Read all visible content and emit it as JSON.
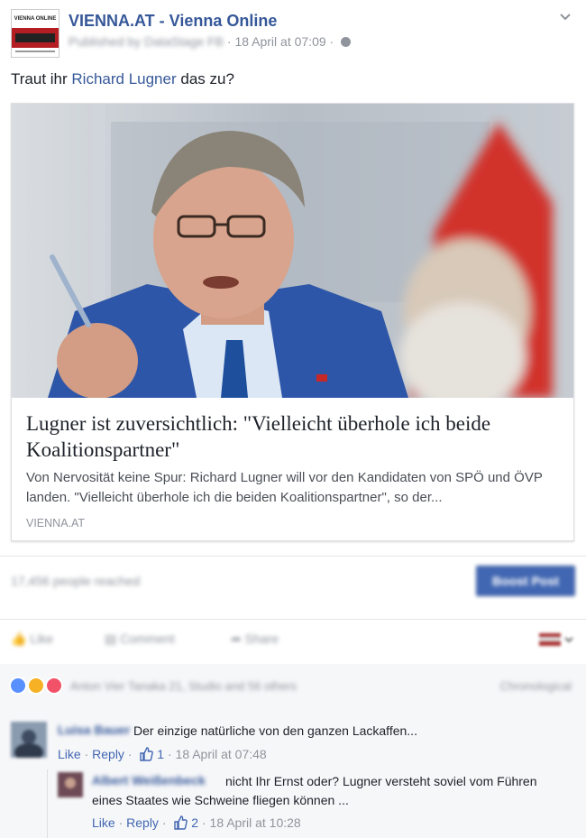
{
  "post": {
    "page_name": "VIENNA.AT - Vienna Online",
    "logo_text": "VIENNA ONLINE",
    "published_by": "Published by DataStage FB",
    "timestamp": "18 April at 07:09",
    "text_before": "Traut ihr ",
    "text_link": "Richard Lugner",
    "text_after": " das zu?"
  },
  "link_card": {
    "title": "Lugner ist zuversichtlich: \"Vielleicht überhole ich beide Koalitionspartner\"",
    "description": "Von Nervosität keine Spur: Richard Lugner will vor den Kandidaten von SPÖ und ÖVP landen. \"Vielleicht überhole ich die beiden Koalitionspartner\", so der...",
    "source": "VIENNA.AT"
  },
  "reach": {
    "text": "17,456 people reached",
    "boost_label": "Boost Post"
  },
  "actions": {
    "like": "Like",
    "comment": "Comment",
    "share": "Share"
  },
  "reactions": {
    "summary": "Anton Vier Tanaka 21, Studio and 56 others",
    "order": "Chronological"
  },
  "comments": [
    {
      "author": "Luisa Bauer",
      "text": "Der einzige natürliche von den ganzen Lackaffen...",
      "like_label": "Like",
      "reply_label": "Reply",
      "likes": "1",
      "time": "18 April at 07:48"
    },
    {
      "author": "Albert Weißenbeck",
      "text": "nicht Ihr Ernst oder? Lugner versteht soviel vom Führen eines Staates wie Schweine fliegen können ...",
      "like_label": "Like",
      "reply_label": "Reply",
      "likes": "2",
      "time": "18 April at 10:28"
    }
  ],
  "colors": {
    "link": "#365899",
    "boost": "#4267b2",
    "logo_red": "#b41e23"
  }
}
